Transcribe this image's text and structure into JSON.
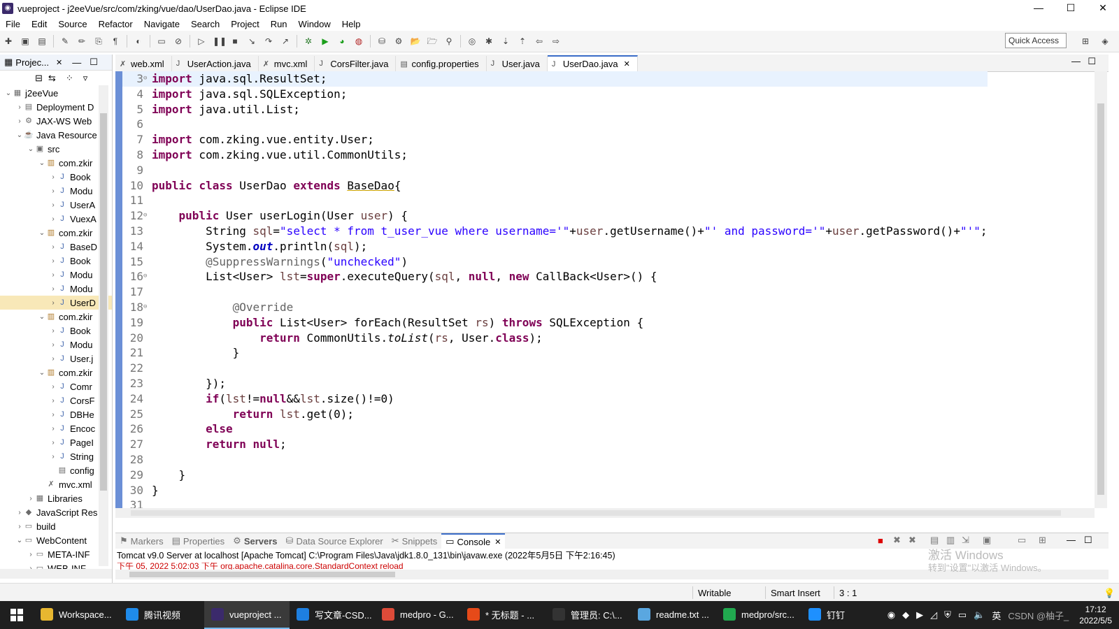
{
  "window": {
    "title": "vueproject - j2eeVue/src/com/zking/vue/dao/UserDao.java - Eclipse IDE",
    "controls": {
      "minimize": "—",
      "maximize": "☐",
      "close": "✕"
    }
  },
  "menu": [
    "File",
    "Edit",
    "Source",
    "Refactor",
    "Navigate",
    "Search",
    "Project",
    "Run",
    "Window",
    "Help"
  ],
  "quick_access": "Quick Access",
  "explorer": {
    "tab": "Projec...",
    "tab_close": "✕",
    "items": [
      {
        "label": "j2eeVue",
        "icon": "project-icon"
      },
      {
        "label": "Deployment D",
        "icon": "deployment-icon"
      },
      {
        "label": "JAX-WS Web",
        "icon": "webservice-icon"
      },
      {
        "label": "Java Resource",
        "icon": "java-resources-icon"
      },
      {
        "label": "src",
        "icon": "source-folder-icon"
      },
      {
        "label": "com.zkir",
        "icon": "package-icon"
      },
      {
        "label": "Book",
        "icon": "java-file-icon"
      },
      {
        "label": "Modu",
        "icon": "java-file-icon"
      },
      {
        "label": "UserA",
        "icon": "java-file-icon"
      },
      {
        "label": "VuexA",
        "icon": "java-file-icon"
      },
      {
        "label": "com.zkir",
        "icon": "package-icon"
      },
      {
        "label": "BaseD",
        "icon": "java-file-icon"
      },
      {
        "label": "Book",
        "icon": "java-file-icon"
      },
      {
        "label": "Modu",
        "icon": "java-file-icon"
      },
      {
        "label": "Modu",
        "icon": "java-file-icon"
      },
      {
        "label": "UserD",
        "icon": "java-file-icon"
      },
      {
        "label": "com.zkir",
        "icon": "package-icon"
      },
      {
        "label": "Book",
        "icon": "java-file-icon"
      },
      {
        "label": "Modu",
        "icon": "java-file-icon"
      },
      {
        "label": "User.j",
        "icon": "java-file-icon"
      },
      {
        "label": "com.zkir",
        "icon": "package-icon"
      },
      {
        "label": "Comr",
        "icon": "java-file-icon"
      },
      {
        "label": "CorsF",
        "icon": "java-file-icon"
      },
      {
        "label": "DBHe",
        "icon": "java-file-icon"
      },
      {
        "label": "Encoc",
        "icon": "java-file-icon"
      },
      {
        "label": "PageI",
        "icon": "java-file-icon"
      },
      {
        "label": "String",
        "icon": "java-file-icon"
      },
      {
        "label": "config",
        "icon": "properties-file-icon"
      },
      {
        "label": "mvc.xml",
        "icon": "xml-file-icon"
      },
      {
        "label": "Libraries",
        "icon": "library-icon"
      },
      {
        "label": "JavaScript Res",
        "icon": "js-resources-icon"
      },
      {
        "label": "build",
        "icon": "folder-icon"
      },
      {
        "label": "WebContent",
        "icon": "folder-icon"
      },
      {
        "label": "META-INF",
        "icon": "folder-icon"
      },
      {
        "label": "WEB-INF",
        "icon": "folder-icon"
      }
    ]
  },
  "editor": {
    "tabs": [
      {
        "label": "web.xml",
        "icon": "xml-file-icon"
      },
      {
        "label": "UserAction.java",
        "icon": "java-file-icon"
      },
      {
        "label": "mvc.xml",
        "icon": "xml-file-icon"
      },
      {
        "label": "CorsFilter.java",
        "icon": "java-file-icon"
      },
      {
        "label": "config.properties",
        "icon": "properties-file-icon"
      },
      {
        "label": "User.java",
        "icon": "java-file-icon"
      },
      {
        "label": "UserDao.java",
        "icon": "java-file-icon",
        "close": "✕"
      }
    ],
    "line_numbers": [
      "3",
      "4",
      "5",
      "6",
      "7",
      "8",
      "9",
      "10",
      "11",
      "12",
      "13",
      "14",
      "15",
      "16",
      "17",
      "18",
      "19",
      "20",
      "21",
      "22",
      "23",
      "24",
      "25",
      "26",
      "27",
      "28",
      "29",
      "30",
      "31"
    ]
  },
  "console": {
    "tabs": [
      "Markers",
      "Properties",
      "Servers",
      "Data Source Explorer",
      "Snippets",
      "Console"
    ],
    "server_line": "Tomcat v9.0 Server at localhost [Apache Tomcat] C:\\Program Files\\Java\\jdk1.8.0_131\\bin\\javaw.exe (2022年5月5日 下午2:16:45)",
    "red_line": "下午 05, 2022 5:02:03 下午 org.apache.catalina.core.StandardContext reload"
  },
  "watermark": {
    "line1": "激活 Windows",
    "line2": "转到\"设置\"以激活 Windows。"
  },
  "status": {
    "writable": "Writable",
    "insert_mode": "Smart Insert",
    "position": "3 : 1"
  },
  "taskbar": {
    "items": [
      {
        "label": "Workspace...",
        "color": "#e8b730"
      },
      {
        "label": "腾讯视频",
        "color": "#1f8bea"
      },
      {
        "label": "vueproject ...",
        "color": "#3b2a6b",
        "active": true
      },
      {
        "label": "写文章-CSD...",
        "color": "#1e7fe0"
      },
      {
        "label": "medpro - G...",
        "color": "#dd4b39"
      },
      {
        "label": "* 无标题 - ...",
        "color": "#e64a19"
      },
      {
        "label": "管理员: C:\\...",
        "color": "#333333"
      },
      {
        "label": "readme.txt ...",
        "color": "#5aa7e0"
      },
      {
        "label": "medpro/src...",
        "color": "#21a94f"
      },
      {
        "label": "钉钉",
        "color": "#1e90ff"
      }
    ],
    "tray_ime": "英",
    "tray_csdn": "CSDN @柚子_",
    "time": "17:12",
    "date": "2022/5/5"
  }
}
